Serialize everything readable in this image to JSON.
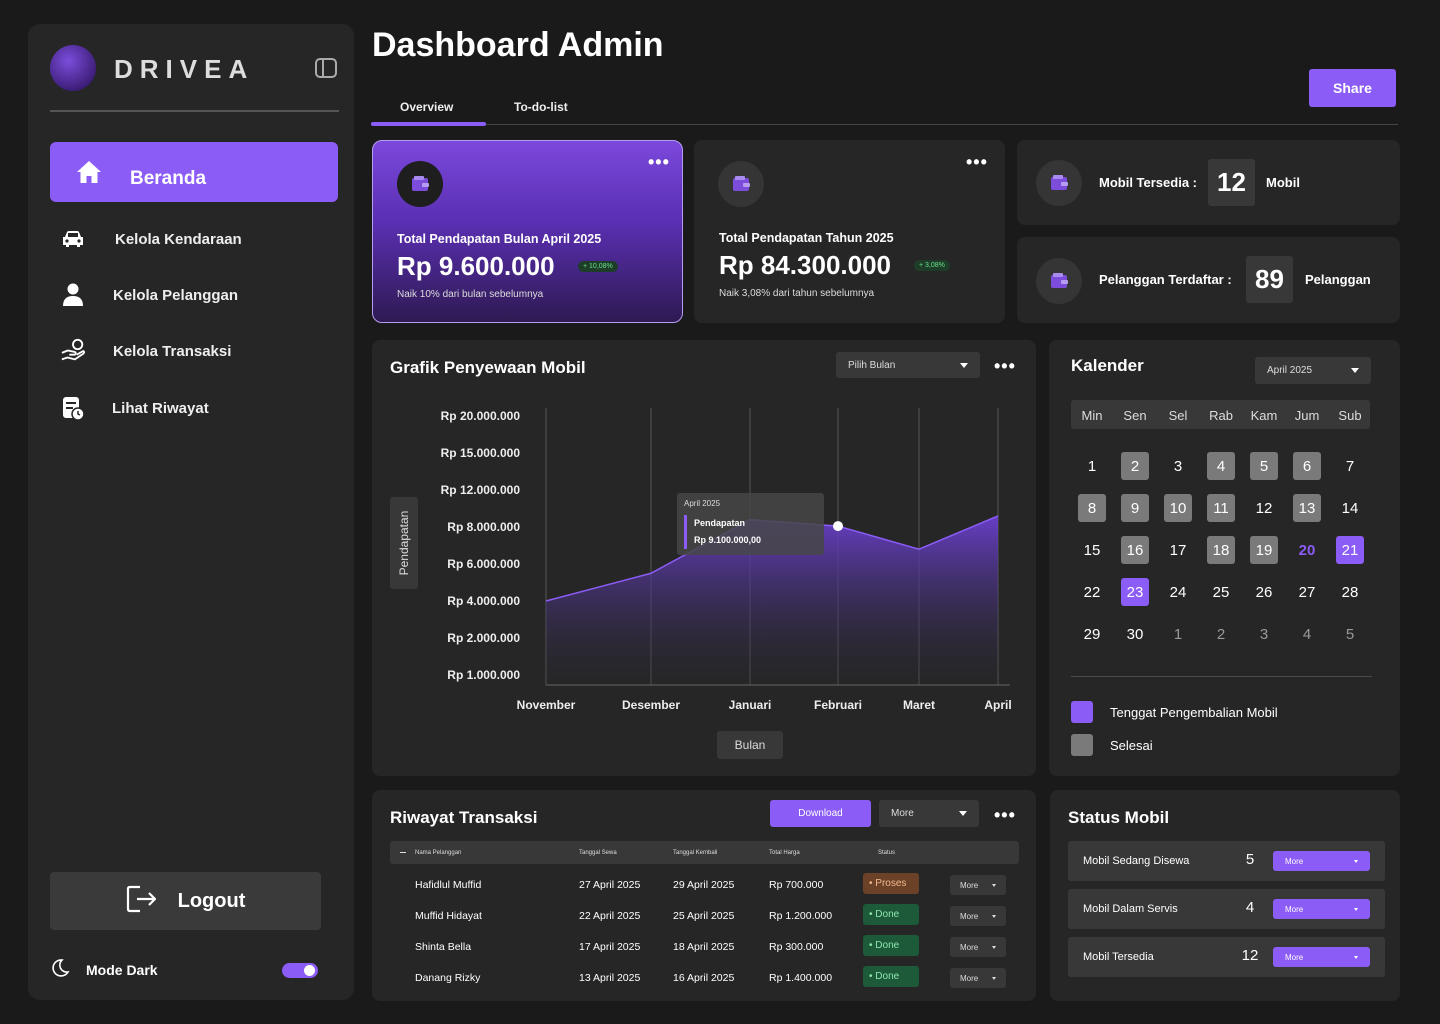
{
  "brand": "DRIVEA",
  "sidebar": {
    "items": [
      {
        "label": "Beranda",
        "icon": "home-icon"
      },
      {
        "label": "Kelola Kendaraan",
        "icon": "car-icon"
      },
      {
        "label": "Kelola Pelanggan",
        "icon": "user-icon"
      },
      {
        "label": "Kelola Transaksi",
        "icon": "hand-coin-icon"
      },
      {
        "label": "Lihat Riwayat",
        "icon": "history-icon"
      }
    ],
    "logout": "Logout",
    "mode": "Mode Dark",
    "dark_mode_on": true
  },
  "header": {
    "title": "Dashboard Admin",
    "share": "Share",
    "tabs": [
      "Overview",
      "To-do-list"
    ],
    "active_tab": "Overview"
  },
  "cards": {
    "monthly": {
      "label": "Total Pendapatan Bulan April 2025",
      "value": "Rp 9.600.000",
      "badge": "+ 10,08%",
      "note": "Naik 10% dari bulan sebelumnya"
    },
    "yearly": {
      "label": "Total Pendapatan Tahun 2025",
      "value": "Rp 84.300.000",
      "badge": "+ 3,08%",
      "note": "Naik 3,08% dari tahun sebelumnya"
    },
    "cars": {
      "label": "Mobil Tersedia :",
      "value": "12",
      "unit": "Mobil"
    },
    "customers": {
      "label": "Pelanggan Terdaftar :",
      "value": "89",
      "unit": "Pelanggan"
    }
  },
  "chart": {
    "title": "Grafik Penyewaan Mobil",
    "select": "Pilih Bulan",
    "tooltip": {
      "period": "April 2025",
      "label": "Pendapatan",
      "value": "Rp 9.100.000,00"
    }
  },
  "chart_data": {
    "type": "area",
    "title": "Grafik Penyewaan Mobil",
    "xlabel": "Bulan",
    "ylabel": "Pendapatan",
    "y_ticks": [
      "Rp 20.000.000",
      "Rp 15.000.000",
      "Rp 12.000.000",
      "Rp 8.000.000",
      "Rp 6.000.000",
      "Rp 4.000.000",
      "Rp 2.000.000",
      "Rp 1.000.000"
    ],
    "categories": [
      "November",
      "Desember",
      "Januari",
      "Februari",
      "Maret",
      "April"
    ],
    "series": [
      {
        "name": "Pendapatan",
        "values": [
          4000000,
          5500000,
          8800000,
          8100000,
          6800000,
          9200000
        ]
      }
    ],
    "highlight_index": 3,
    "grid": "vertical",
    "color": "#8b5cf6"
  },
  "calendar": {
    "title": "Kalender",
    "select": "April 2025",
    "day_names": [
      "Min",
      "Sen",
      "Sel",
      "Rab",
      "Kam",
      "Jum",
      "Sub"
    ],
    "weeks": [
      [
        {
          "d": "1"
        },
        {
          "d": "2",
          "s": "gray"
        },
        {
          "d": "3"
        },
        {
          "d": "4",
          "s": "gray"
        },
        {
          "d": "5",
          "s": "gray"
        },
        {
          "d": "6",
          "s": "gray"
        },
        {
          "d": "7"
        }
      ],
      [
        {
          "d": "8",
          "s": "gray"
        },
        {
          "d": "9",
          "s": "gray"
        },
        {
          "d": "10",
          "s": "gray"
        },
        {
          "d": "11",
          "s": "gray"
        },
        {
          "d": "12"
        },
        {
          "d": "13",
          "s": "gray"
        },
        {
          "d": "14"
        }
      ],
      [
        {
          "d": "15"
        },
        {
          "d": "16",
          "s": "gray"
        },
        {
          "d": "17"
        },
        {
          "d": "18",
          "s": "gray"
        },
        {
          "d": "19",
          "s": "gray"
        },
        {
          "d": "20",
          "s": "ptext"
        },
        {
          "d": "21",
          "s": "purple"
        }
      ],
      [
        {
          "d": "22"
        },
        {
          "d": "23",
          "s": "purple"
        },
        {
          "d": "24"
        },
        {
          "d": "25"
        },
        {
          "d": "26"
        },
        {
          "d": "27"
        },
        {
          "d": "28"
        }
      ],
      [
        {
          "d": "29"
        },
        {
          "d": "30"
        },
        {
          "d": "1",
          "s": "out"
        },
        {
          "d": "2",
          "s": "out"
        },
        {
          "d": "3",
          "s": "out"
        },
        {
          "d": "4",
          "s": "out"
        },
        {
          "d": "5",
          "s": "out"
        }
      ]
    ],
    "legend": [
      {
        "label": "Tenggat Pengembalian Mobil",
        "color": "#8b5cf6"
      },
      {
        "label": "Selesai",
        "color": "#7a7a7a"
      }
    ]
  },
  "transactions": {
    "title": "Riwayat Transaksi",
    "download": "Download",
    "more": "More",
    "headers": [
      "Nama Pelanggan",
      "Tanggal Sewa",
      "Tanggal Kembali",
      "Total Harga",
      "Status"
    ],
    "rows": [
      {
        "name": "Hafidlul Muffid",
        "rent": "27 April 2025",
        "ret": "29 April 2025",
        "total": "Rp 700.000",
        "status": "• Proses",
        "kind": "proses",
        "more": "More"
      },
      {
        "name": "Muffid Hidayat",
        "rent": "22 April 2025",
        "ret": "25 April 2025",
        "total": "Rp 1.200.000",
        "status": "• Done",
        "kind": "done",
        "more": "More"
      },
      {
        "name": "Shinta Bella",
        "rent": "17 April 2025",
        "ret": "18 April 2025",
        "total": "Rp 300.000",
        "status": "• Done",
        "kind": "done",
        "more": "More"
      },
      {
        "name": "Danang Rizky",
        "rent": "13 April 2025",
        "ret": "16 April 2025",
        "total": "Rp 1.400.000",
        "status": "• Done",
        "kind": "done",
        "more": "More"
      }
    ]
  },
  "status_mobil": {
    "title": "Status Mobil",
    "rows": [
      {
        "label": "Mobil Sedang Disewa",
        "count": "5",
        "more": "More"
      },
      {
        "label": "Mobil Dalam Servis",
        "count": "4",
        "more": "More"
      },
      {
        "label": "Mobil Tersedia",
        "count": "12",
        "more": "More"
      }
    ]
  }
}
